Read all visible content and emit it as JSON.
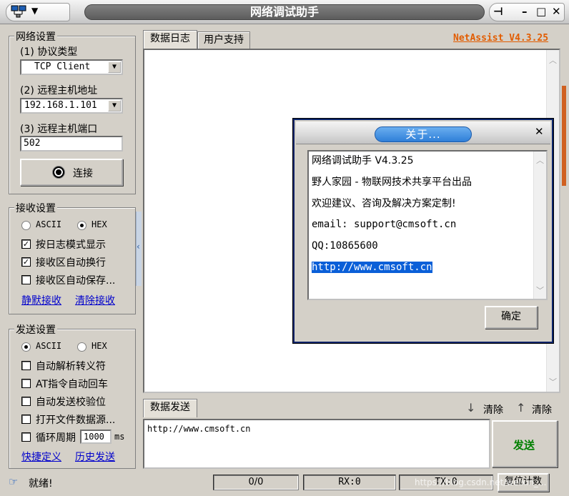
{
  "window": {
    "title": "网络调试助手",
    "menu_arrow": "▼",
    "pin": "⊣",
    "minimize": "–",
    "maximize": "□",
    "close": "✕"
  },
  "network": {
    "title": "网络设置",
    "protocol_label": "(1) 协议类型",
    "protocol_value": "TCP Client",
    "host_label": "(2) 远程主机地址",
    "host_value": "192.168.1.101",
    "port_label": "(3) 远程主机端口",
    "port_value": "502",
    "connect_label": "连接"
  },
  "receive": {
    "title": "接收设置",
    "ascii_label": "ASCII",
    "hex_label": "HEX",
    "selected_mode": "HEX",
    "option_log": "按日志模式显示",
    "option_wrap": "接收区自动换行",
    "option_save": "接收区自动保存...",
    "log_checked": true,
    "wrap_checked": true,
    "save_checked": false,
    "link_silent": "静默接收",
    "link_clear": "清除接收"
  },
  "send": {
    "title": "发送设置",
    "ascii_label": "ASCII",
    "hex_label": "HEX",
    "selected_mode": "ASCII",
    "opt_escape": "自动解析转义符",
    "opt_at": "AT指令自动回车",
    "opt_checksum": "自动发送校验位",
    "opt_file": "打开文件数据源...",
    "opt_loop": "循环周期",
    "loop_value": "1000",
    "loop_unit": "ms",
    "link_shortcut": "快捷定义",
    "link_history": "历史发送"
  },
  "tabs": {
    "log": "数据日志",
    "support": "用户支持",
    "brand": "NetAssist V4.3.25"
  },
  "send_area": {
    "tab_label": "数据发送",
    "clear1": "清除",
    "clear2": "清除",
    "text": "http://www.cmsoft.cn",
    "send_button": "发送"
  },
  "about_dialog": {
    "title": "关于...",
    "close": "✕",
    "line1": "网络调试助手 V4.3.25",
    "line2": "野人家园 - 物联网技术共享平台出品",
    "line3": "欢迎建议、咨询及解决方案定制!",
    "line4": "email: support@cmsoft.cn",
    "line5": "QQ:10865600",
    "line6": "http://www.cmsoft.cn",
    "ok_button": "确定"
  },
  "status": {
    "ready": "就绪!",
    "counter": "0/0",
    "rx": "RX:0",
    "tx": "TX:0",
    "reset": "复位计数"
  },
  "watermark": "https://blog.csdn.net/weixin_...",
  "colors": {
    "brand_orange": "#e25c00",
    "send_green": "#008000",
    "link_blue": "#0000cc",
    "selection_blue": "#0a5fd8",
    "dialog_title_blue": "#2f7fd8"
  }
}
